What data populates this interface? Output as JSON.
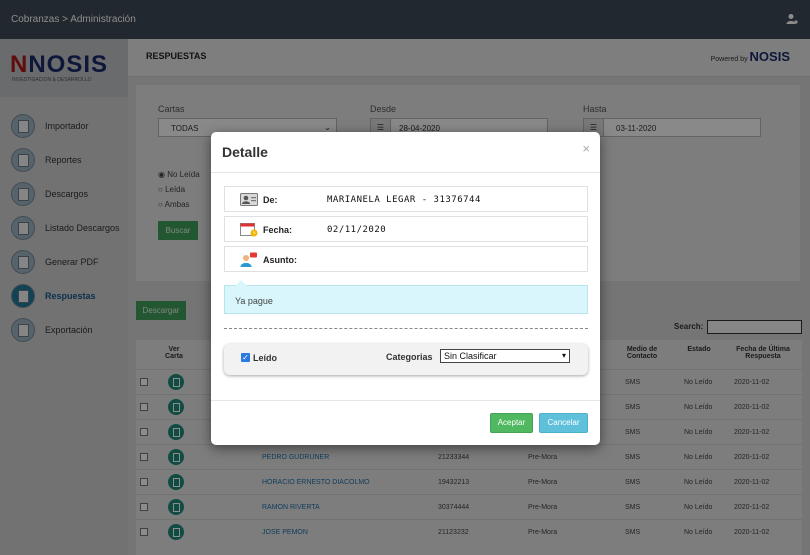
{
  "topbar": {
    "breadcrumb": "Cobranzas > Administración",
    "user_icon": "user-settings-icon"
  },
  "sidebar": {
    "logo": {
      "brand": "NOSIS",
      "sub": "INVESTIGACION & DESARROLLO"
    },
    "items": [
      {
        "label": "Importador",
        "icon": "import-icon"
      },
      {
        "label": "Reportes",
        "icon": "report-icon"
      },
      {
        "label": "Descargos",
        "icon": "user-icon"
      },
      {
        "label": "Listado Descargos",
        "icon": "list-icon"
      },
      {
        "label": "Generar PDF",
        "icon": "pdf-icon"
      },
      {
        "label": "Respuestas",
        "icon": "pdf-icon",
        "active": true
      },
      {
        "label": "Exportación",
        "icon": "export-icon"
      }
    ]
  },
  "page": {
    "title": "RESPUESTAS",
    "powered_prefix": "Powered by",
    "powered_brand": "NOSIS"
  },
  "filters": {
    "cartas_label": "Cartas",
    "cartas_value": "TODAS",
    "desde_label": "Desde",
    "desde_value": "28-04-2020",
    "hasta_label": "Hasta",
    "hasta_value": "03-11-2020",
    "radios": [
      "No Leída",
      "Leída",
      "Ambas"
    ],
    "buscar": "Buscar"
  },
  "toolbar": {
    "descargar": "Descargar",
    "search_label": "Search:"
  },
  "table": {
    "headers": {
      "ver_carta": "Ver Carta",
      "medio_contacto": "Medio de Contacto",
      "estado": "Estado",
      "fecha": "Fecha de Última Respuesta"
    },
    "rows": [
      {
        "name": "",
        "doc": "",
        "tipo": "",
        "medio": "SMS",
        "estado": "No Leído",
        "fecha": "2020-11-02"
      },
      {
        "name": "",
        "doc": "",
        "tipo": "",
        "medio": "SMS",
        "estado": "No Leído",
        "fecha": "2020-11-02"
      },
      {
        "name": "",
        "doc": "",
        "tipo": "",
        "medio": "SMS",
        "estado": "No Leído",
        "fecha": "2020-11-02"
      },
      {
        "name": "PEDRO GUDRUNER",
        "doc": "21233344",
        "tipo": "Pre-Mora",
        "medio": "SMS",
        "estado": "No Leído",
        "fecha": "2020-11-02"
      },
      {
        "name": "HORACIO ERNESTO DIACOLMO",
        "doc": "19432213",
        "tipo": "Pre-Mora",
        "medio": "SMS",
        "estado": "No Leído",
        "fecha": "2020-11-02"
      },
      {
        "name": "RAMON RIVERTA",
        "doc": "30374444",
        "tipo": "Pre-Mora",
        "medio": "SMS",
        "estado": "No Leído",
        "fecha": "2020-11-02"
      },
      {
        "name": "JOSE PEMON",
        "doc": "21123232",
        "tipo": "Pre-Mora",
        "medio": "SMS",
        "estado": "No Leído",
        "fecha": "2020-11-02"
      }
    ]
  },
  "modal": {
    "title": "Detalle",
    "close": "×",
    "de_label": "De:",
    "de_value": "MARIANELA LEGAR - 31376744",
    "fecha_label": "Fecha:",
    "fecha_value": "02/11/2020",
    "asunto_label": "Asunto:",
    "asunto_value": "",
    "message": "Ya pague",
    "leido_label": "Leído",
    "leido_checked": true,
    "categorias_label": "Categorias",
    "categorias_value": "Sin Clasificar",
    "aceptar": "Aceptar",
    "cancelar": "Cancelar"
  }
}
